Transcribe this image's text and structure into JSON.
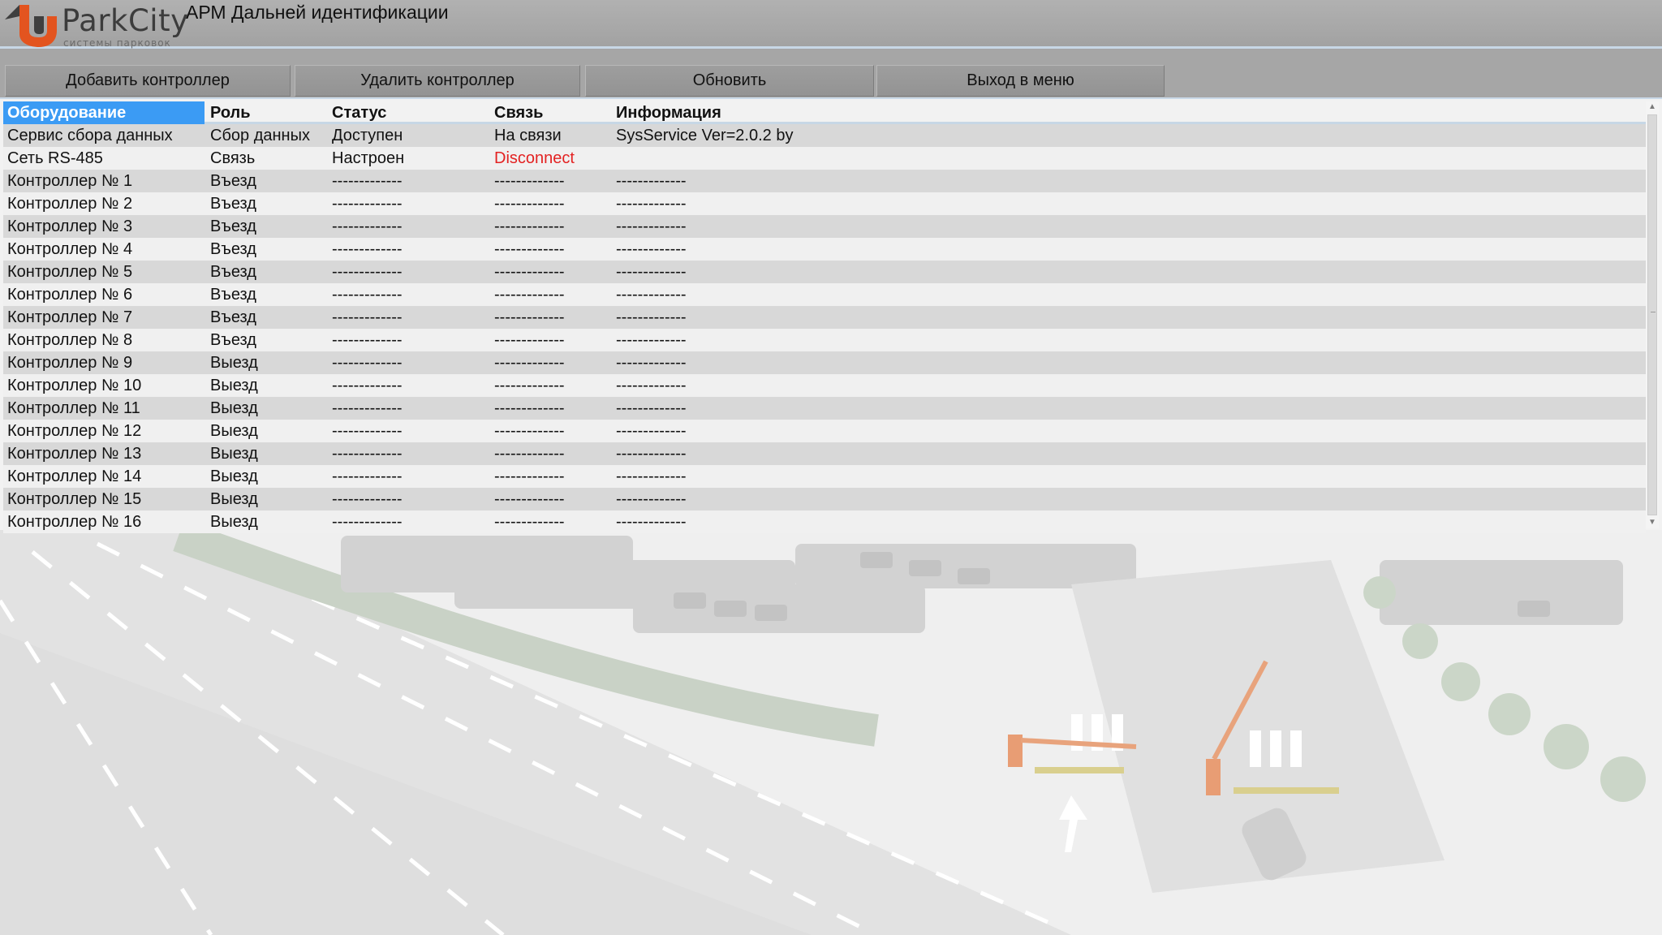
{
  "app": {
    "logo_text": "ParkCity",
    "logo_subtitle": "системы парковок",
    "title": "АРМ Дальней идентификации"
  },
  "toolbar": {
    "add_label": "Добавить контроллер",
    "delete_label": "Удалить контроллер",
    "refresh_label": "Обновить",
    "exit_label": "Выход в меню"
  },
  "table": {
    "columns": [
      "Оборудование",
      "Роль",
      "Статус",
      "Связь",
      "Информация"
    ],
    "selected_header": "Оборудование",
    "rows": [
      [
        "Сервис сбора данных",
        "Сбор данных",
        "Доступен",
        "На связи",
        "SysService Ver=2.0.2 by"
      ],
      [
        "Сеть RS-485",
        "Связь",
        "Настроен",
        "Disconnect",
        ""
      ],
      [
        "Контроллер № 1",
        "Въезд",
        "-------------",
        "-------------",
        "-------------"
      ],
      [
        "Контроллер № 2",
        "Въезд",
        "-------------",
        "-------------",
        "-------------"
      ],
      [
        "Контроллер № 3",
        "Въезд",
        "-------------",
        "-------------",
        "-------------"
      ],
      [
        "Контроллер № 4",
        "Въезд",
        "-------------",
        "-------------",
        "-------------"
      ],
      [
        "Контроллер № 5",
        "Въезд",
        "-------------",
        "-------------",
        "-------------"
      ],
      [
        "Контроллер № 6",
        "Въезд",
        "-------------",
        "-------------",
        "-------------"
      ],
      [
        "Контроллер № 7",
        "Въезд",
        "-------------",
        "-------------",
        "-------------"
      ],
      [
        "Контроллер № 8",
        "Въезд",
        "-------------",
        "-------------",
        "-------------"
      ],
      [
        "Контроллер № 9",
        "Выезд",
        "-------------",
        "-------------",
        "-------------"
      ],
      [
        "Контроллер № 10",
        "Выезд",
        "-------------",
        "-------------",
        "-------------"
      ],
      [
        "Контроллер № 11",
        "Выезд",
        "-------------",
        "-------------",
        "-------------"
      ],
      [
        "Контроллер № 12",
        "Выезд",
        "-------------",
        "-------------",
        "-------------"
      ],
      [
        "Контроллер № 13",
        "Выезд",
        "-------------",
        "-------------",
        "-------------"
      ],
      [
        "Контроллер № 14",
        "Выезд",
        "-------------",
        "-------------",
        "-------------"
      ],
      [
        "Контроллер № 15",
        "Выезд",
        "-------------",
        "-------------",
        "-------------"
      ],
      [
        "Контроллер № 16",
        "Выезд",
        "-------------",
        "-------------",
        "-------------"
      ]
    ],
    "error_value": "Disconnect"
  },
  "colors": {
    "selection": "#3b9bf4",
    "error": "#e32222",
    "logo_accent": "#e3541f"
  },
  "icons": {
    "logo": "parkcity-logo-icon",
    "scroll_up": "scroll-up-arrow-icon",
    "scroll_down": "scroll-down-arrow-icon"
  }
}
